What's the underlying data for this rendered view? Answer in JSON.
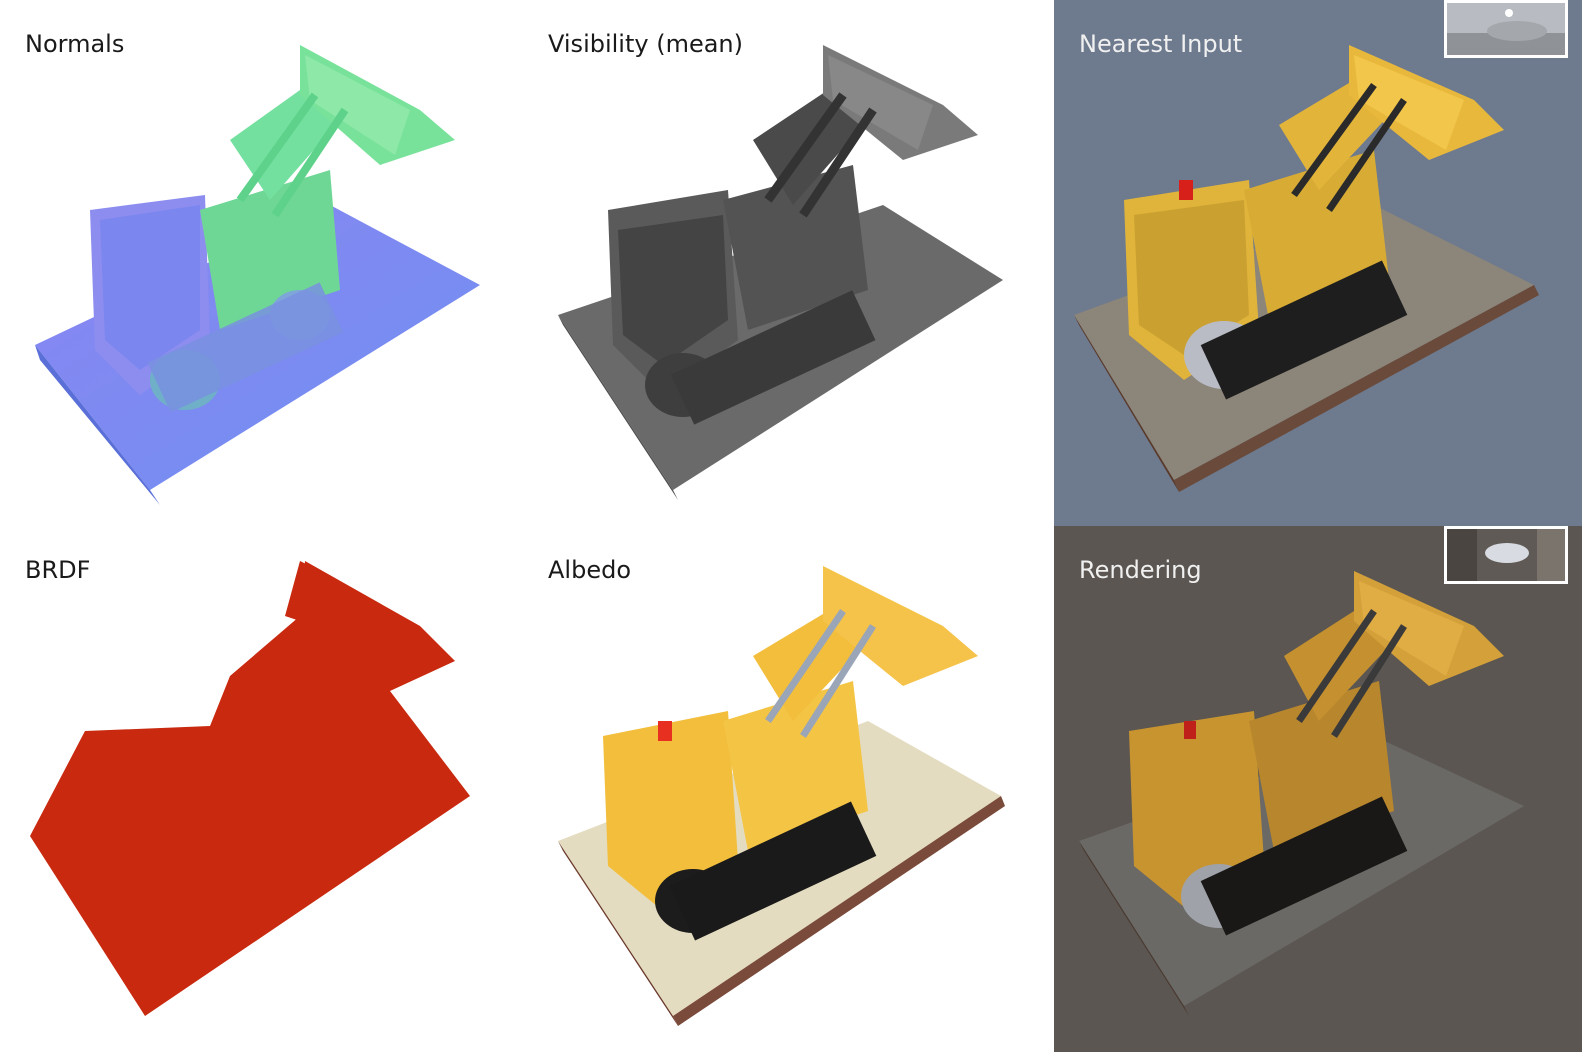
{
  "panels": {
    "normals": {
      "label": "Normals"
    },
    "visibility": {
      "label": "Visibility (mean)"
    },
    "nearest_input": {
      "label": "Nearest Input"
    },
    "brdf": {
      "label": "BRDF"
    },
    "albedo": {
      "label": "Albedo"
    },
    "rendering": {
      "label": "Rendering"
    }
  },
  "colors": {
    "nearest_bg": "#6e7a8e",
    "rendering_bg": "#5b5651",
    "brdf_red": "#c8290f",
    "albedo_yellow": "#f2be3c",
    "normals_blue": "#7b8cf0",
    "normals_green": "#6fe08a",
    "visibility_gray": "#5a5a5a"
  }
}
